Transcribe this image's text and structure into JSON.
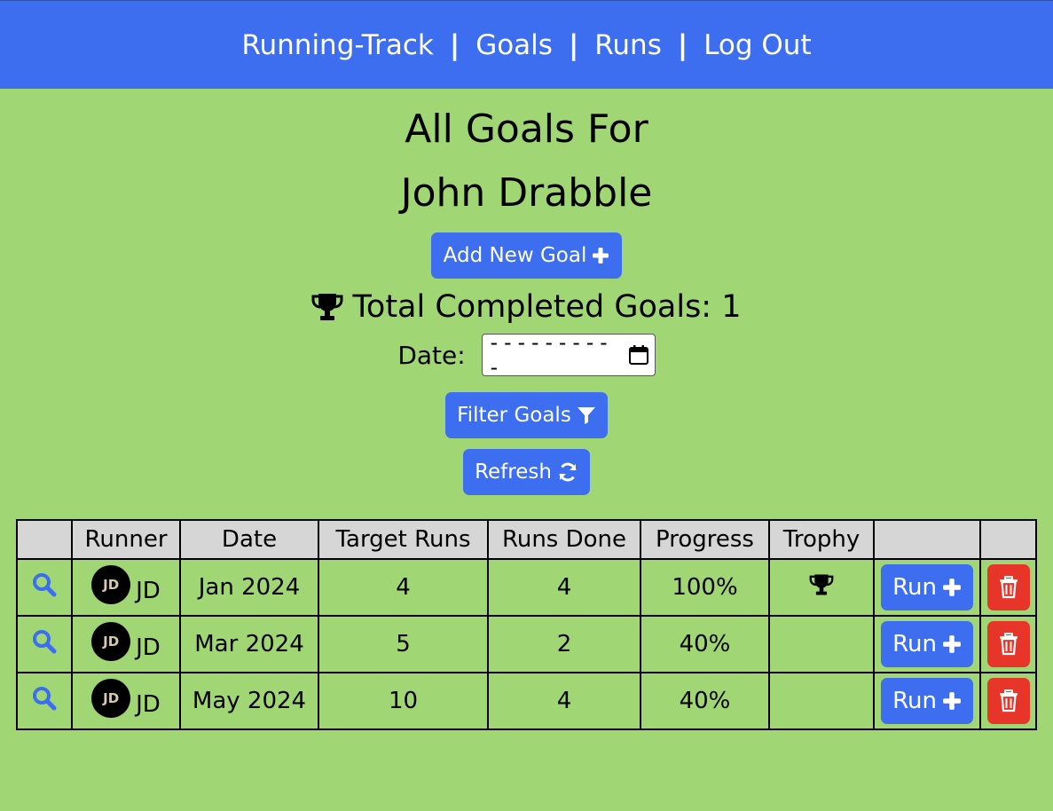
{
  "nav": {
    "brand": "Running-Track",
    "separator": "|",
    "goals": "Goals",
    "runs": "Runs",
    "logout": "Log Out"
  },
  "page": {
    "title_line1": "All Goals For",
    "title_line2": "John Drabble",
    "add_goal_label": "Add New Goal",
    "completed_label": "Total Completed Goals: 1",
    "date_label": "Date:",
    "date_placeholder": "---------  -",
    "filter_label": "Filter Goals",
    "refresh_label": "Refresh"
  },
  "table": {
    "headers": [
      "",
      "Runner",
      "Date",
      "Target Runs",
      "Runs Done",
      "Progress",
      "Trophy",
      "",
      ""
    ],
    "rows": [
      {
        "runner": "JD",
        "avatar": "JD",
        "date": "Jan 2024",
        "target": "4",
        "done": "4",
        "progress": "100%",
        "trophy": true,
        "run_label": "Run"
      },
      {
        "runner": "JD",
        "avatar": "JD",
        "date": "Mar 2024",
        "target": "5",
        "done": "2",
        "progress": "40%",
        "trophy": false,
        "run_label": "Run"
      },
      {
        "runner": "JD",
        "avatar": "JD",
        "date": "May 2024",
        "target": "10",
        "done": "4",
        "progress": "40%",
        "trophy": false,
        "run_label": "Run"
      }
    ]
  },
  "colors": {
    "background": "#a1d674",
    "navbar": "#3d6ef0",
    "primary_button": "#3d6ef0",
    "delete_button": "#e8352a",
    "header_row": "#d6d6d6"
  },
  "icons": {
    "add": "plus-icon",
    "trophy": "trophy-icon",
    "calendar": "calendar-icon",
    "filter": "filter-icon",
    "refresh": "refresh-icon",
    "view": "search-icon",
    "delete": "trash-icon"
  }
}
